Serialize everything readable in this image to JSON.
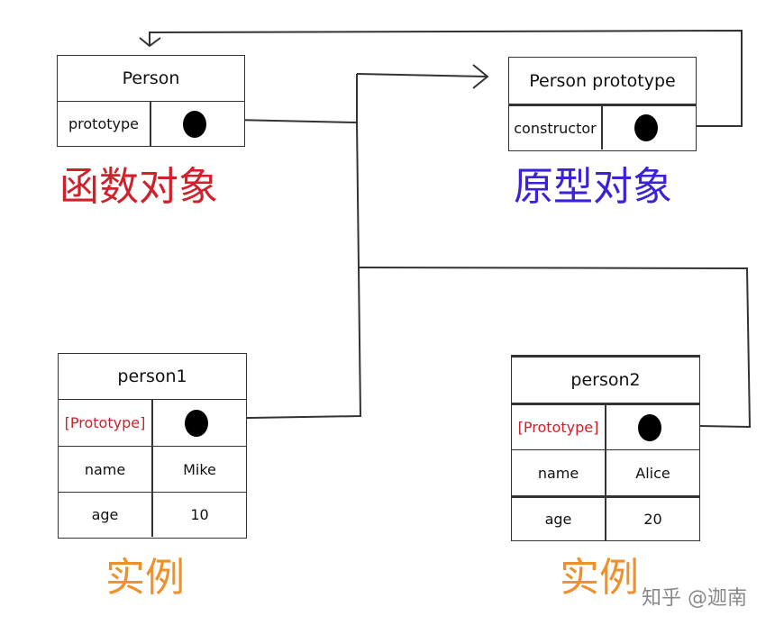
{
  "person": {
    "title": "Person",
    "key": "prototype",
    "caption": "函数对象"
  },
  "person_prototype": {
    "title": "Person prototype",
    "key": "constructor",
    "caption": "原型对象"
  },
  "person1": {
    "title": "person1",
    "proto_key": "[Prototype]",
    "rows": [
      {
        "key": "name",
        "value": "Mike"
      },
      {
        "key": "age",
        "value": "10"
      }
    ],
    "caption": "实例"
  },
  "person2": {
    "title": "person2",
    "proto_key": "[Prototype]",
    "rows": [
      {
        "key": "name",
        "value": "Alice"
      },
      {
        "key": "age",
        "value": "20"
      }
    ],
    "caption": "实例"
  },
  "watermark": "知乎 @迦南",
  "colors": {
    "function_caption": "#d0202a",
    "prototype_caption": "#3a22d8",
    "instance_caption": "#f0902a",
    "proto_key": "#d0202a"
  }
}
